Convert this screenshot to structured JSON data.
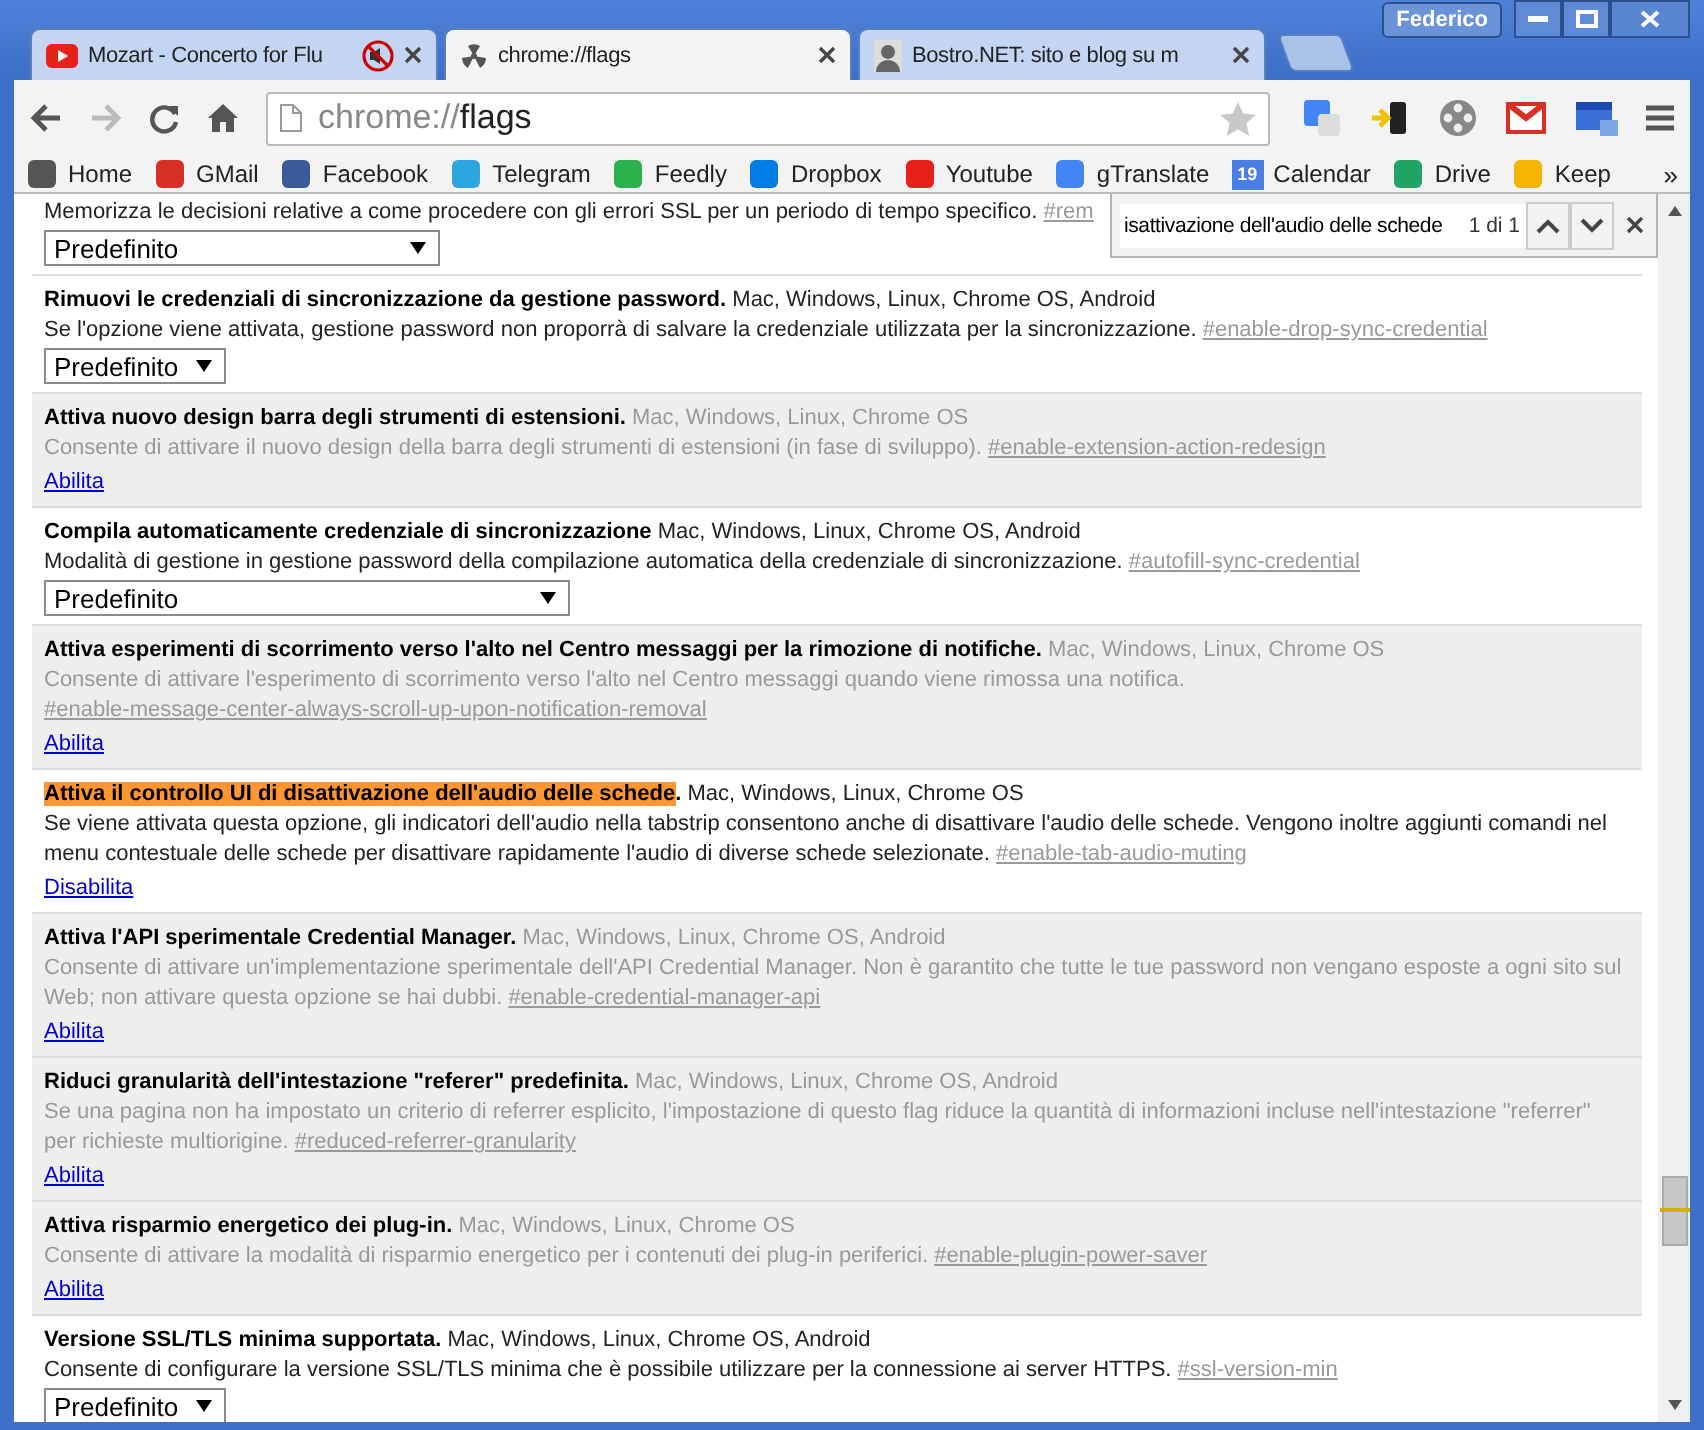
{
  "profile": "Federico",
  "tabs": [
    {
      "title": "Mozart - Concerto for Flu",
      "muted": true,
      "selected": false
    },
    {
      "title": "chrome://flags",
      "muted": false,
      "selected": true
    },
    {
      "title": "Bostro.NET: sito e blog su m",
      "muted": false,
      "selected": false
    }
  ],
  "address": {
    "scheme": "chrome://",
    "host": "flags"
  },
  "bookmarks": [
    {
      "label": "Home"
    },
    {
      "label": "GMail"
    },
    {
      "label": "Facebook"
    },
    {
      "label": "Telegram"
    },
    {
      "label": "Feedly"
    },
    {
      "label": "Dropbox"
    },
    {
      "label": "Youtube"
    },
    {
      "label": "gTranslate"
    },
    {
      "label": "Calendar",
      "badge": "19"
    },
    {
      "label": "Drive"
    },
    {
      "label": "Keep"
    }
  ],
  "bookmarks_more": "»",
  "find_bar": {
    "query": "isattivazione dell'audio delle schede",
    "count": "1 di 1"
  },
  "experiments": [
    {
      "enabled": true,
      "description": "Memorizza le decisioni relative a come procedere con gli errori SSL per un periodo di tempo specifico.",
      "tag": "#rem",
      "control": {
        "kind": "select",
        "value": "Predefinito"
      }
    },
    {
      "enabled": true,
      "title": "Rimuovi le credenziali di sincronizzazione da gestione password",
      "title_end": ".",
      "platforms": "Mac, Windows, Linux, Chrome OS, Android",
      "description": "Se l'opzione viene attivata, gestione password non proporrà di salvare la credenziale utilizzata per la sincronizzazione.",
      "tag": "#enable-drop-sync-credential",
      "control": {
        "kind": "select",
        "value": "Predefinito"
      }
    },
    {
      "enabled": false,
      "title": "Attiva nuovo design barra degli strumenti di estensioni",
      "title_end": ".",
      "platforms": "Mac, Windows, Linux, Chrome OS",
      "description": "Consente di attivare il nuovo design della barra degli strumenti di estensioni (in fase di sviluppo).",
      "tag": "#enable-extension-action-redesign",
      "control": {
        "kind": "link",
        "value": "Abilita"
      }
    },
    {
      "enabled": true,
      "title": "Compila automaticamente credenziale di sincronizzazione",
      "platforms": "Mac, Windows, Linux, Chrome OS, Android",
      "description": "Modalità di gestione in gestione password della compilazione automatica della credenziale di sincronizzazione.",
      "tag": "#autofill-sync-credential",
      "control": {
        "kind": "select",
        "value": "Predefinito"
      }
    },
    {
      "enabled": false,
      "title": "Attiva esperimenti di scorrimento verso l'alto nel Centro messaggi per la rimozione di notifiche",
      "title_end": ".",
      "platforms": "Mac, Windows, Linux, Chrome OS",
      "description": "Consente di attivare l'esperimento di scorrimento verso l'alto nel Centro messaggi quando viene rimossa una notifica.",
      "tag": "#enable-message-center-always-scroll-up-upon-notification-removal",
      "control": {
        "kind": "link",
        "value": "Abilita"
      }
    },
    {
      "enabled": true,
      "highlighted": true,
      "title": "Attiva il controllo UI di disattivazione dell'audio delle schede",
      "title_end": ".",
      "platforms": "Mac, Windows, Linux, Chrome OS",
      "description": "Se viene attivata questa opzione, gli indicatori dell'audio nella tabstrip consentono anche di disattivare l'audio delle schede. Vengono inoltre aggiunti comandi nel menu contestuale delle schede per disattivare rapidamente l'audio di diverse schede selezionate.",
      "tag": "#enable-tab-audio-muting",
      "control": {
        "kind": "link",
        "value": "Disabilita"
      }
    },
    {
      "enabled": false,
      "title": "Attiva l'API sperimentale Credential Manager",
      "title_end": ".",
      "platforms": "Mac, Windows, Linux, Chrome OS, Android",
      "description": "Consente di attivare un'implementazione sperimentale dell'API Credential Manager. Non è garantito che tutte le tue password non vengano esposte a ogni sito sul Web; non attivare questa opzione se hai dubbi.",
      "tag": "#enable-credential-manager-api",
      "control": {
        "kind": "link",
        "value": "Abilita"
      }
    },
    {
      "enabled": false,
      "title": "Riduci granularità dell'intestazione \"referer\" predefinita",
      "title_end": ".",
      "platforms": "Mac, Windows, Linux, Chrome OS, Android",
      "description": "Se una pagina non ha impostato un criterio di referrer esplicito, l'impostazione di questo flag riduce la quantità di informazioni incluse nell'intestazione \"referrer\" per richieste multiorigine.",
      "tag": "#reduced-referrer-granularity",
      "control": {
        "kind": "link",
        "value": "Abilita"
      }
    },
    {
      "enabled": false,
      "title": "Attiva risparmio energetico dei plug-in",
      "title_end": ".",
      "platforms": "Mac, Windows, Linux, Chrome OS",
      "description": "Consente di attivare la modalità di risparmio energetico per i contenuti dei plug-in periferici.",
      "tag": "#enable-plugin-power-saver",
      "control": {
        "kind": "link",
        "value": "Abilita"
      }
    },
    {
      "enabled": true,
      "title": "Versione SSL/TLS minima supportata",
      "title_end": ".",
      "platforms": "Mac, Windows, Linux, Chrome OS, Android",
      "description": "Consente di configurare la versione SSL/TLS minima che è possibile utilizzare per la connessione ai server HTTPS.",
      "tag": "#ssl-version-min",
      "control": {
        "kind": "select",
        "value": "Predefinito"
      }
    }
  ]
}
